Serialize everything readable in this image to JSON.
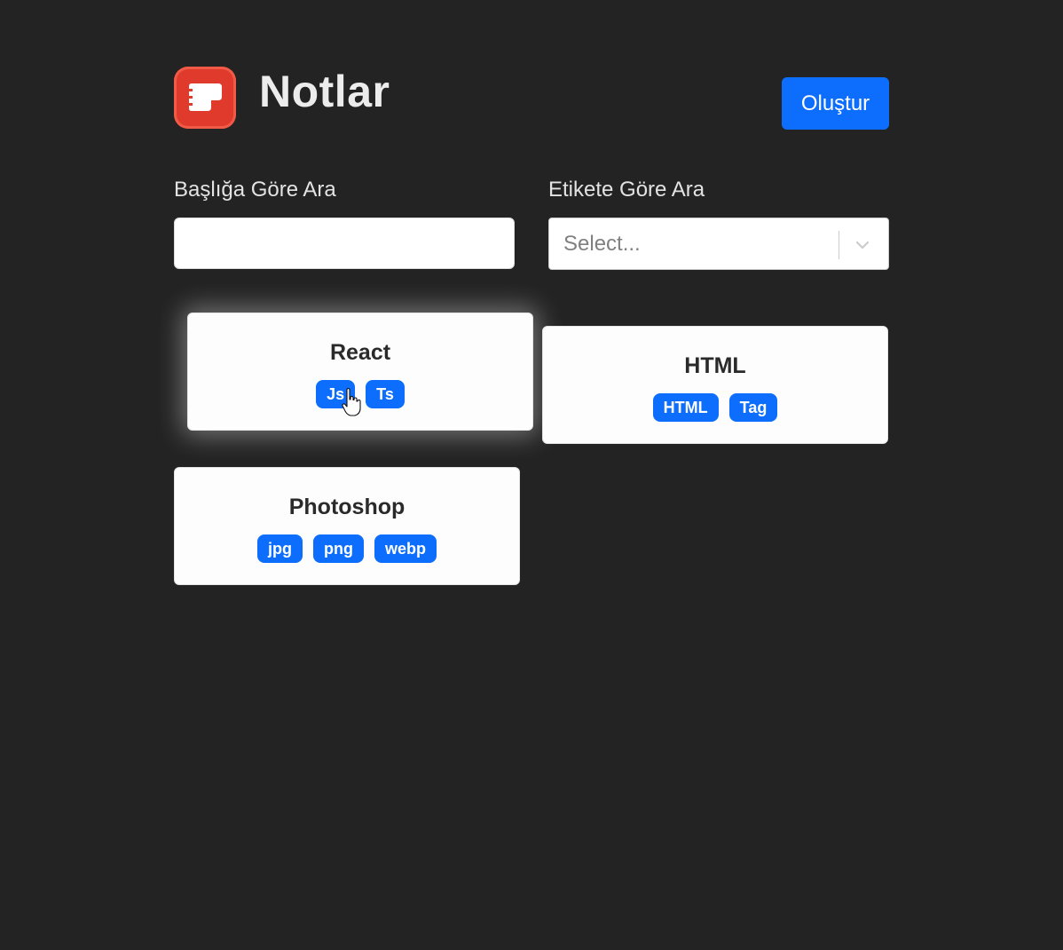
{
  "header": {
    "app_title": "Notlar",
    "create_label": "Oluştur",
    "logo_icon": "notes-logo-icon",
    "accent": "#0d6efd",
    "logo_color": "#e03a2c"
  },
  "filters": {
    "title_label": "Başlığa Göre Ara",
    "title_value": "",
    "tag_label": "Etikete Göre Ara",
    "tag_placeholder": "Select..."
  },
  "notes": [
    {
      "title": "React",
      "tags": [
        "Js",
        "Ts"
      ]
    },
    {
      "title": "HTML",
      "tags": [
        "HTML",
        "Tag"
      ]
    },
    {
      "title": "Photoshop",
      "tags": [
        "jpg",
        "png",
        "webp"
      ]
    }
  ]
}
